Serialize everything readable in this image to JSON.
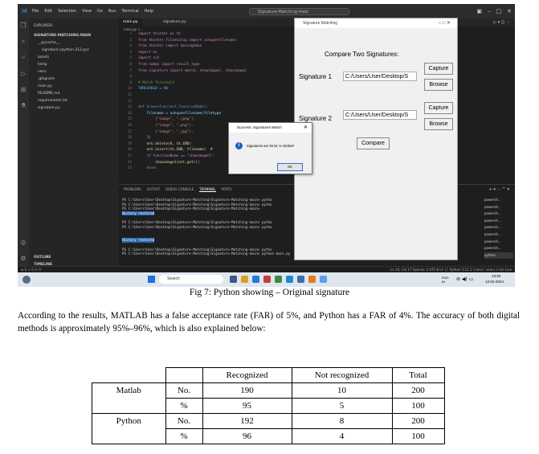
{
  "vscode": {
    "menu": [
      "File",
      "Edit",
      "Selection",
      "View",
      "Go",
      "Run",
      "Terminal",
      "Help"
    ],
    "search_placeholder": "Signature-Matching-main",
    "explorer_title": "EXPLORER",
    "project": "SIGNATURE-MATCHING-MAIN",
    "tree": [
      {
        "label": "__pycache__",
        "indent": 1
      },
      {
        "label": "signature.cpython-312.pyc",
        "indent": 2
      },
      {
        "label": "assets",
        "indent": 1
      },
      {
        "label": "temp",
        "indent": 1
      },
      {
        "label": "venv",
        "indent": 1
      },
      {
        "label": ".gitignore",
        "indent": 1
      },
      {
        "label": "main.py",
        "indent": 1
      },
      {
        "label": "README.md",
        "indent": 1
      },
      {
        "label": "requirements.txt",
        "indent": 1
      },
      {
        "label": "signature.py",
        "indent": 1
      }
    ],
    "outline": "OUTLINE",
    "timeline": "TIMELINE",
    "tabs": [
      "main.py",
      "signature.py"
    ],
    "breadcrumb": "main.py > ...",
    "code": [
      {
        "n": "1",
        "t": "import tkinter as tk"
      },
      {
        "n": "2",
        "t": "from tkinter.filedialog import askopenfilename"
      },
      {
        "n": "3",
        "t": "from tkinter import messagebox"
      },
      {
        "n": "4",
        "t": "import os"
      },
      {
        "n": "5",
        "t": "import cv2"
      },
      {
        "n": "6",
        "t": "from numpy import result_type"
      },
      {
        "n": "7",
        "t": "from signature import match, showimage1, showimage2"
      },
      {
        "n": "8",
        "t": ""
      },
      {
        "n": "9",
        "t": "# Match Threshold"
      },
      {
        "n": "10",
        "t": "THRESHOLD = 90"
      },
      {
        "n": "11",
        "t": ""
      },
      {
        "n": "12",
        "t": ""
      },
      {
        "n": "13",
        "t": "def browsefunc(ent,functionName):"
      },
      {
        "n": "14",
        "t": "    filename = askopenfilename(filetype"
      },
      {
        "n": "15",
        "t": "        (\"image\", \".jpeg\"),"
      },
      {
        "n": "16",
        "t": "        (\"image\", \".png\"),"
      },
      {
        "n": "17",
        "t": "        (\"image\", \".jpg\"),"
      },
      {
        "n": "18",
        "t": "    ])"
      },
      {
        "n": "19",
        "t": "    ent.delete(0, tk.END)"
      },
      {
        "n": "20",
        "t": "    ent.insert(tk.END, filename)  #"
      },
      {
        "n": "21",
        "t": "    if functionName == \"showimage1\":"
      },
      {
        "n": "22",
        "t": "        showimage1(ent.get())"
      },
      {
        "n": "23",
        "t": "    else:"
      }
    ],
    "panel_tabs": [
      "PROBLEMS",
      "OUTPUT",
      "DEBUG CONSOLE",
      "TERMINAL",
      "PORTS"
    ],
    "terminal": [
      "PS C:\\Users\\User\\Desktop\\Signature-Matching\\Signature-Matching-main> pytho",
      "PS C:\\Users\\User\\Desktop\\Signature-Matching\\Signature-Matching-main> pytho",
      "PS C:\\Users\\User\\Desktop\\Signature-Matching\\Signature-Matching-main>",
      "History restored",
      "",
      "PS C:\\Users\\User\\Desktop\\Signature-Matching\\Signature-Matching-main> pytho",
      "PS C:\\Users\\User\\Desktop\\Signature-Matching\\Signature-Matching-main> pytho",
      "",
      "",
      "History restored",
      "",
      "PS C:\\Users\\User\\Desktop\\Signature-Matching\\Signature-Matching-main> pytho",
      "PS C:\\Users\\User\\Desktop\\Signature-Matching\\Signature-Matching-main> python main.py"
    ],
    "terminal_list": [
      "powersh...",
      "powersh...",
      "powersh...",
      "powersh...",
      "powersh...",
      "powersh...",
      "powersh...",
      "powersh...",
      "python"
    ],
    "status_left": "⊗ 0 ⚠ 0   ⓦ 0",
    "status_right": "Ln 10, Col 17   Spaces: 4   UTF-8   LF   {} Python   3.12.1 ('venv': venv)   ⊙ Go Live",
    "taskbar_search": "Search",
    "tray_lang": "ENG IN",
    "tray_time": "13:20",
    "tray_date": "13-02-2024"
  },
  "tk_app": {
    "title": "Signature Matching",
    "heading": "Compare Two Signatures:",
    "sig1_label": "Signature 1",
    "sig1_path": "C:/Users/User/Desktop/S",
    "sig2_label": "Signature 2",
    "sig2_path": "C:/Users/User/Desktop/S",
    "capture": "Capture",
    "browse": "Browse",
    "compare": "Compare"
  },
  "dialog": {
    "title": "Success: Signatures Match",
    "message": "Signatures are 92.51 % similar!!",
    "ok": "OK"
  },
  "document": {
    "caption": "Fig 7: Python showing – Original signature",
    "paragraph": "According to the results, MATLAB has a false acceptance rate (FAR) of 5%, and Python has a FAR of 4%. The accuracy of both digital methods is approximately 95%–96%, which is also explained below:",
    "table": {
      "headers": [
        "",
        "",
        "Recognized",
        "Not recognized",
        "Total"
      ],
      "rows": [
        [
          "Matlab",
          "No.",
          "190",
          "10",
          "200"
        ],
        [
          "",
          "%",
          "95",
          "5",
          "100"
        ],
        [
          "Python",
          "No.",
          "192",
          "8",
          "200"
        ],
        [
          "",
          "%",
          "96",
          "4",
          "100"
        ]
      ]
    }
  }
}
